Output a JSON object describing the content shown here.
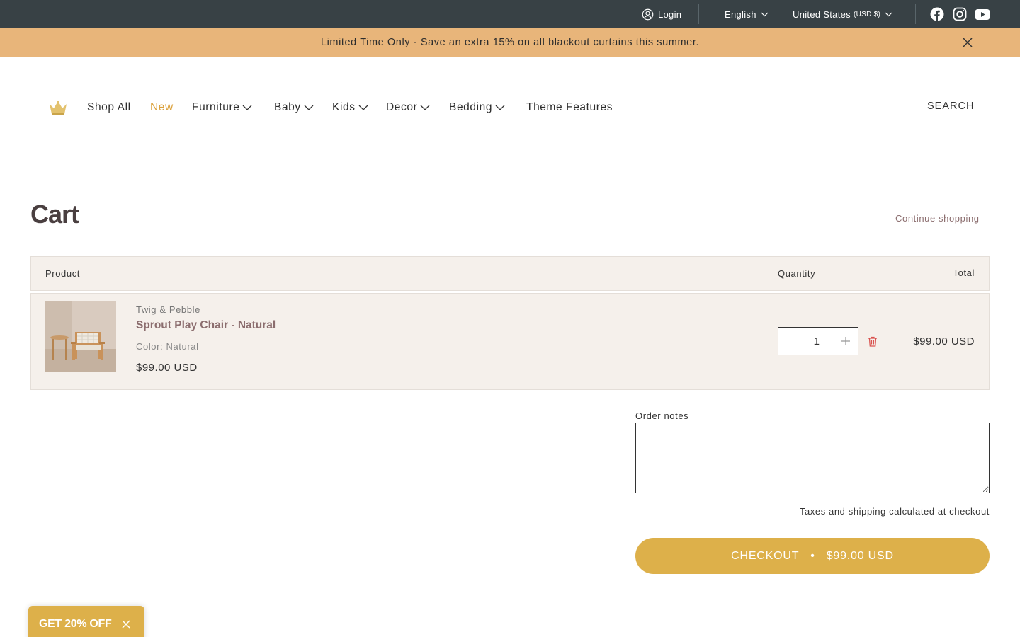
{
  "topbar": {
    "login_label": "Login",
    "language": "English",
    "country": "United States",
    "currency": "(USD $)",
    "social_icons": [
      "facebook-icon",
      "instagram-icon",
      "youtube-icon"
    ]
  },
  "announcement": {
    "text": "Limited Time Only - Save an extra 15% on all blackout curtains this summer."
  },
  "nav": {
    "items": [
      {
        "label": "Shop All"
      },
      {
        "label": "New"
      },
      {
        "label": "Furniture"
      },
      {
        "label": "Baby"
      },
      {
        "label": "Kids"
      },
      {
        "label": "Decor"
      },
      {
        "label": "Bedding"
      },
      {
        "label": "Theme Features"
      }
    ],
    "search_label": "SEARCH"
  },
  "cart": {
    "title": "Cart",
    "continue_label": "Continue shopping",
    "headers": {
      "product": "Product",
      "quantity": "Quantity",
      "total": "Total"
    },
    "items": [
      {
        "vendor": "Twig & Pebble",
        "name": "Sprout Play Chair - Natural",
        "option": "Color: Natural",
        "price": "$99.00 USD",
        "quantity": "1",
        "line_total": "$99.00 USD"
      }
    ],
    "notes_label": "Order notes",
    "notes_value": "",
    "tax_note": "Taxes and shipping calculated at checkout",
    "checkout_label": "CHECKOUT",
    "checkout_separator": "•",
    "checkout_total": "$99.00 USD"
  },
  "discount_tab": {
    "label": "GET 20% OFF"
  },
  "colors": {
    "topbar_bg": "#384145",
    "announcement_bg": "#e8b57a",
    "accent": "#dba13b",
    "checkout_bg": "#ddb04a",
    "row_bg": "#f5f0eb",
    "product_link": "#8b6d6e",
    "delete": "#d9534f"
  }
}
